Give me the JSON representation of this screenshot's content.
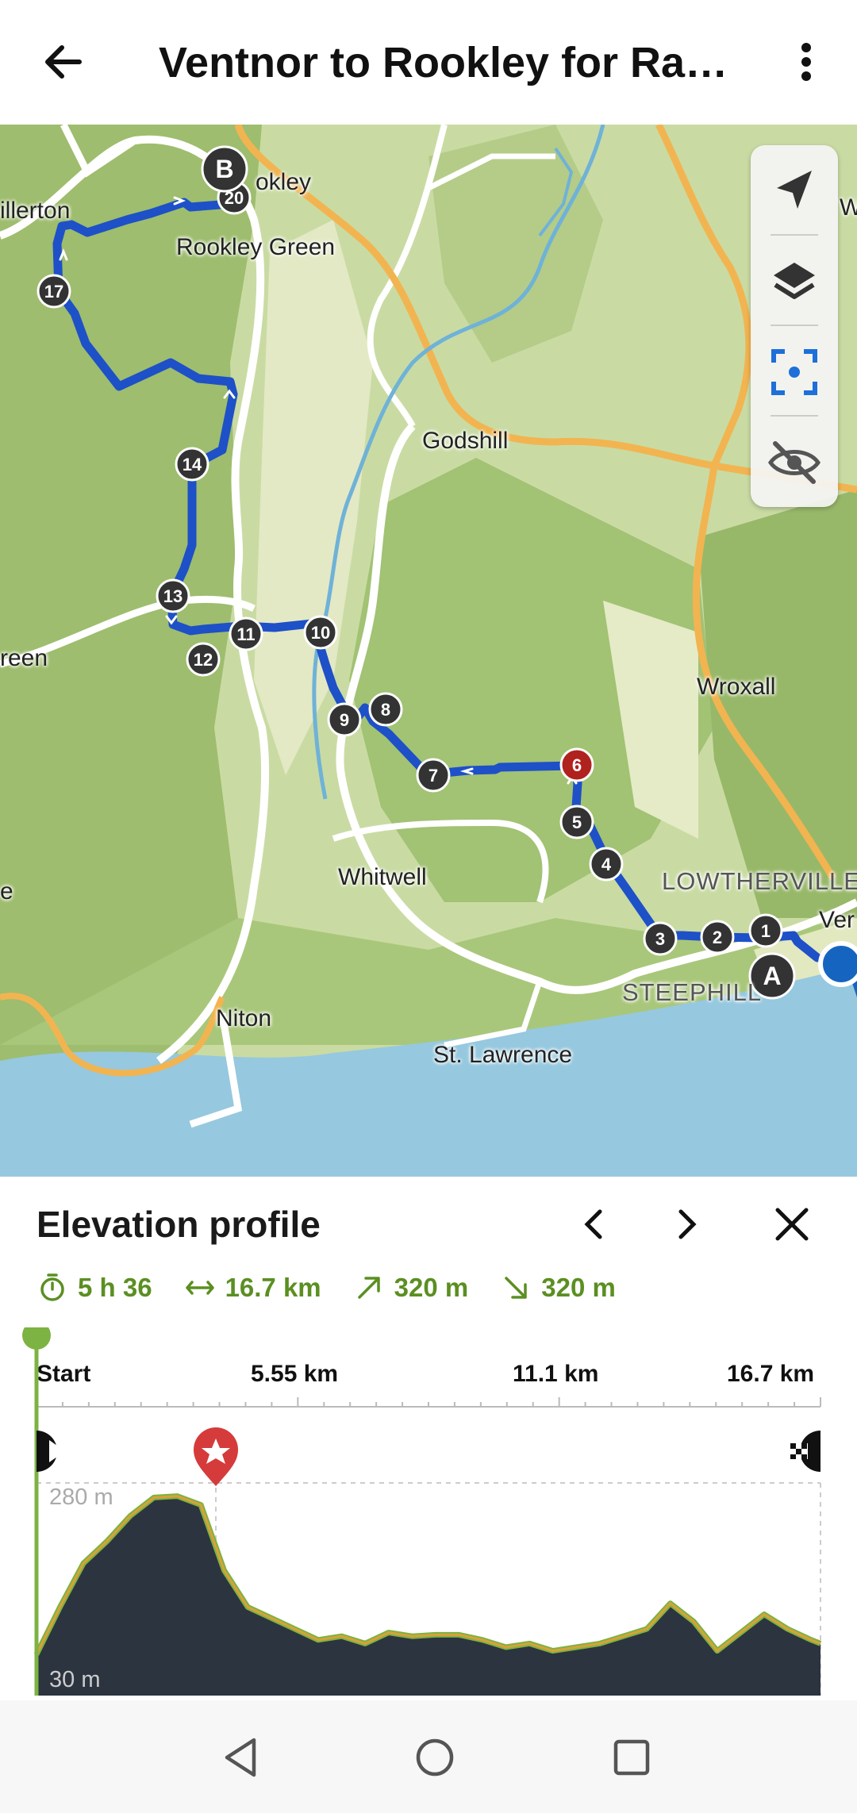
{
  "header": {
    "title": "Ventnor to Rookley for Ram…"
  },
  "map": {
    "place_labels": [
      {
        "name": "rookley",
        "text": "okley"
      },
      {
        "name": "rookley-green",
        "text": "Rookley Green"
      },
      {
        "name": "chillerton",
        "text": "illerton"
      },
      {
        "name": "godshill",
        "text": "Godshill"
      },
      {
        "name": "wroxall",
        "text": "Wroxall"
      },
      {
        "name": "whitwell",
        "text": "Whitwell"
      },
      {
        "name": "lowtherville",
        "text": "LOWTHERVILLE"
      },
      {
        "name": "ventnor",
        "text": "Ver"
      },
      {
        "name": "steephill",
        "text": "STEEPHILL"
      },
      {
        "name": "niton",
        "text": "Niton"
      },
      {
        "name": "st-lawrence",
        "text": "St. Lawrence"
      },
      {
        "name": "green-west",
        "text": "reen"
      },
      {
        "name": "e-west",
        "text": "e"
      },
      {
        "name": "w-east",
        "text": "W"
      }
    ],
    "start_marker": "A",
    "end_marker": "B",
    "waypoints": [
      "1",
      "2",
      "3",
      "4",
      "5",
      "6",
      "7",
      "8",
      "9",
      "10",
      "11",
      "12",
      "13",
      "14",
      "17",
      "20"
    ],
    "highlighted_waypoint": "6",
    "route_color": "#1e50c8",
    "highlight_color": "#b0221e",
    "controls": [
      "navigation-arrow-icon",
      "layers-icon",
      "focus-icon",
      "visibility-off-icon"
    ]
  },
  "elevation": {
    "title": "Elevation profile",
    "stats": {
      "duration": "5 h 36",
      "distance": "16.7 km",
      "ascent": "320 m",
      "descent": "320 m"
    },
    "ticks": [
      "Start",
      "5.55 km",
      "11.1 km",
      "16.7 km"
    ],
    "y_max_label": "280 m",
    "y_min_label": "30 m",
    "accent_color": "#7cb342",
    "profile_color": "#2c3440"
  },
  "chart_data": {
    "type": "area",
    "x": [
      0,
      0.5,
      1,
      1.5,
      2,
      2.5,
      3,
      3.5,
      4,
      4.5,
      5,
      5.5,
      6,
      6.5,
      7,
      7.5,
      8,
      8.5,
      9,
      9.5,
      10,
      10.5,
      11,
      11.5,
      12,
      12.5,
      13,
      13.5,
      14,
      14.5,
      15,
      15.5,
      16,
      16.5,
      16.7
    ],
    "y": [
      45,
      110,
      170,
      200,
      235,
      260,
      262,
      250,
      160,
      110,
      95,
      80,
      65,
      70,
      60,
      75,
      70,
      72,
      72,
      65,
      55,
      60,
      50,
      55,
      60,
      70,
      80,
      115,
      90,
      50,
      75,
      100,
      80,
      65,
      60
    ],
    "xlabel": "",
    "ylabel": "",
    "x_tick_labels": [
      "Start",
      "5.55 km",
      "11.1 km",
      "16.7 km"
    ],
    "y_tick_labels": [
      "280 m",
      "30 m"
    ],
    "xlim": [
      0,
      16.7
    ],
    "ylim": [
      30,
      280
    ],
    "annotations": [
      "start-flag",
      "waypoint-6-star",
      "finish-flag"
    ]
  },
  "navbar": {
    "buttons": [
      "back-nav",
      "home-nav",
      "recents-nav"
    ]
  }
}
